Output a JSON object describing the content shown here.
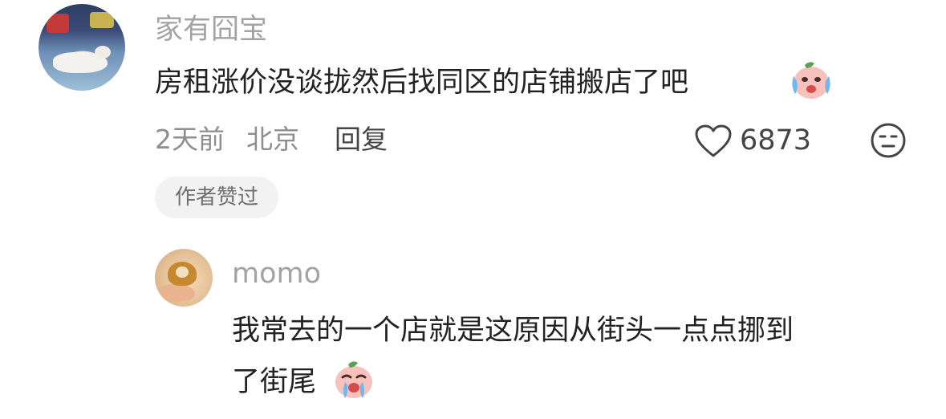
{
  "comment": {
    "username": "家有囧宝",
    "text": "房租涨价没谈拢然后找同区的店铺搬店了吧",
    "time": "2天前",
    "location": "北京",
    "reply_label": "回复",
    "likes": "6873",
    "badge": "作者赞过"
  },
  "reply": {
    "username": "momo",
    "text_line1": "我常去的一个店就是这原因从街头一点点挪到",
    "text_line2": "了街尾"
  },
  "icons": {
    "heart": "heart-outline-icon",
    "emoji_button": "neutral-face-icon",
    "inline_emoji": "peach-crying-sticker"
  },
  "colors": {
    "username": "#a3a3a3",
    "text": "#222222",
    "meta": "#8e8e8e",
    "badge_bg": "#f2f2f2"
  }
}
